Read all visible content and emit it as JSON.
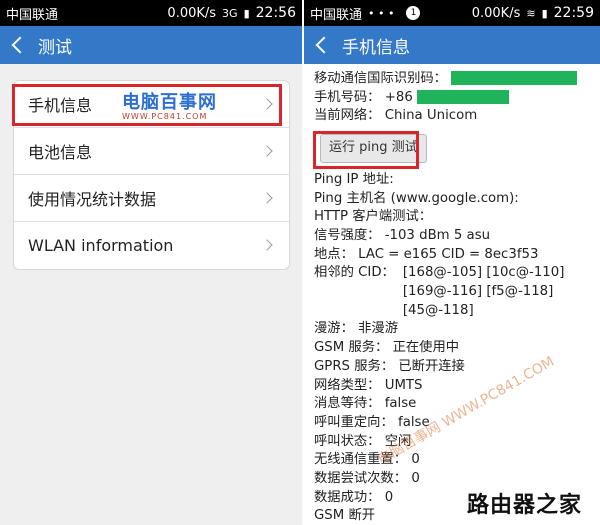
{
  "left": {
    "status": {
      "carrier": "中国联通",
      "speed": "0.00K/s",
      "signal": "3G",
      "time": "22:56"
    },
    "title": "测试",
    "items": [
      {
        "label": "手机信息"
      },
      {
        "label": "电池信息"
      },
      {
        "label": "使用情况统计数据"
      },
      {
        "label": "WLAN information"
      }
    ],
    "watermark": {
      "title": "电脑百事网",
      "url": "WWW.PC841.COM"
    }
  },
  "right": {
    "status": {
      "carrier": "中国联通",
      "dots": "• • •",
      "badge": "1",
      "speed": "0.00K/s",
      "wifi": "≋",
      "time": "22:59"
    },
    "title": "手机信息",
    "fields": {
      "imei_label": "移动通信国际识别码：",
      "phone_label": "手机号码：",
      "phone_prefix": "+86",
      "network_label": "当前网络：",
      "network_value": "China Unicom",
      "ping_button": "运行 ping 测试",
      "ping_ip": "Ping IP 地址:",
      "ping_host": "Ping 主机名 (www.google.com):",
      "http_client": "HTTP 客户端测试：",
      "signal_label": "信号强度：",
      "signal_value": "-103 dBm   5 asu",
      "location_label": "地点：",
      "location_value": "LAC = e165   CID = 8ec3f53",
      "neighbor_label": "相邻的 CID：",
      "neighbor_lines": [
        "[168@-105] [10c@-110]",
        "[169@-116] [f5@-118]",
        "[45@-118]"
      ],
      "roaming_label": "漫游：",
      "roaming_value": "非漫游",
      "gsm_label": "GSM 服务：",
      "gsm_value": "正在使用中",
      "gprs_label": "GPRS 服务：",
      "gprs_value": "已断开连接",
      "nettype_label": "网络类型：",
      "nettype_value": "UMTS",
      "msgwait_label": "消息等待：",
      "msgwait_value": "false",
      "callredir_label": "呼叫重定向：",
      "callredir_value": "false",
      "callstate_label": "呼叫状态：",
      "callstate_value": "空闲",
      "radioreset_label": "无线通信重置：",
      "radioreset_value": "0",
      "dataattempt_label": "数据尝试次数：",
      "dataattempt_value": "0",
      "datasuccess_label": "数据成功：",
      "datasuccess_value": "0",
      "gsmdisc_label": "GSM 断开"
    },
    "watermark": "电脑百事网 WWW.PC841.COM",
    "brand": "路由器之家"
  },
  "colors": {
    "titlebar": "#3478c8",
    "highlight": "#d9262c",
    "redacted": "#1fb45b"
  }
}
